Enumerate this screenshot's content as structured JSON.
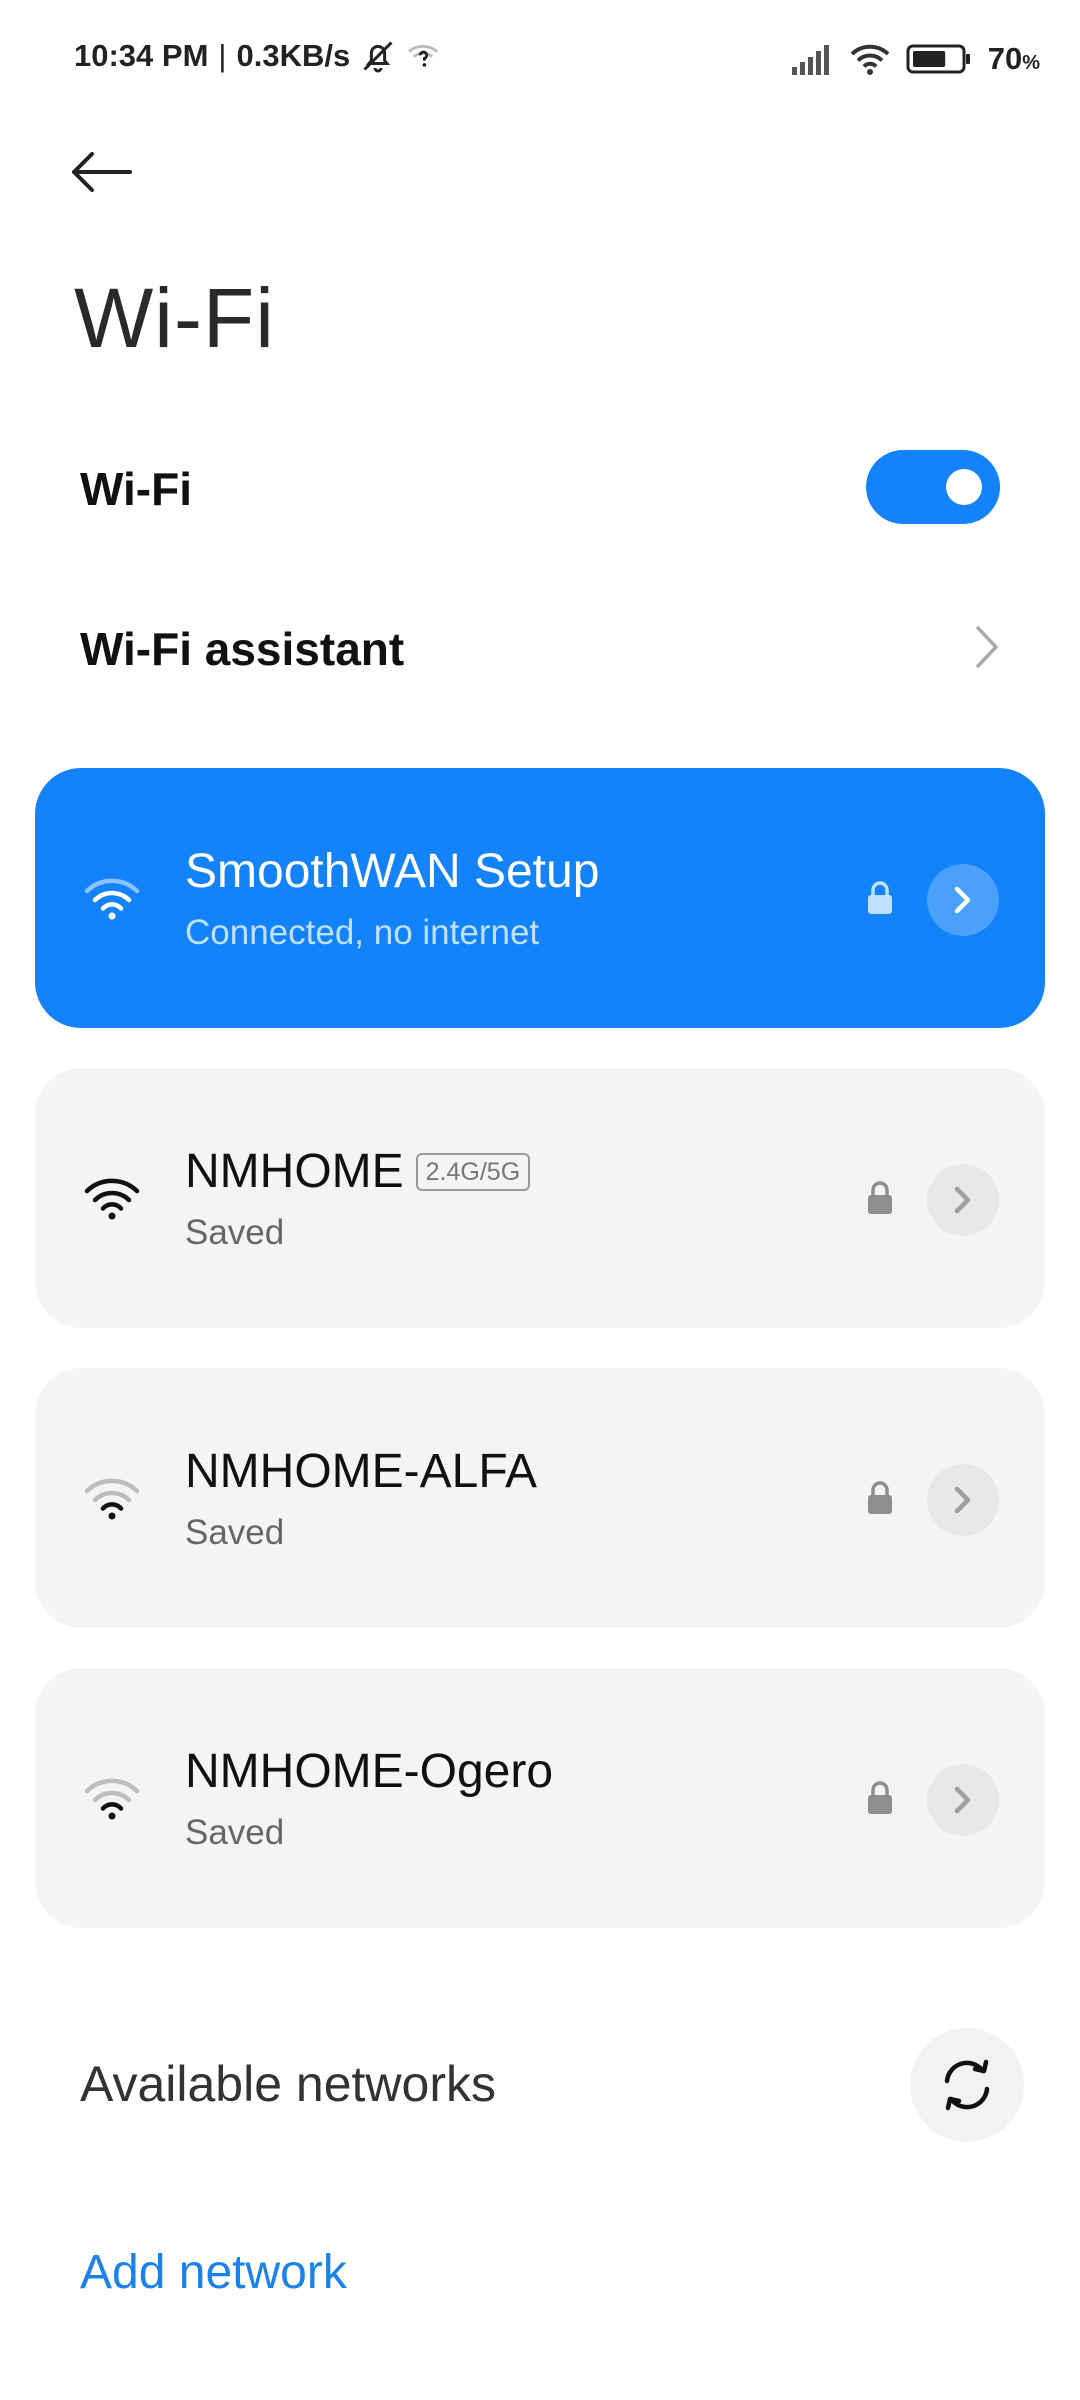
{
  "status_bar": {
    "time": "10:34 PM",
    "separator": "|",
    "speed": "0.3KB/s",
    "battery_value": "70",
    "battery_unit": "%",
    "icons": [
      "bell-off-icon",
      "wifi-question-icon",
      "signal-icon",
      "wifi-icon",
      "battery-icon"
    ]
  },
  "header": {
    "title": "Wi-Fi"
  },
  "wifi_row": {
    "label": "Wi-Fi",
    "enabled": true
  },
  "assistant_row": {
    "label": "Wi-Fi assistant"
  },
  "networks": [
    {
      "name": "SmoothWAN Setup",
      "status": "Connected, no internet",
      "band": "",
      "active": true
    },
    {
      "name": "NMHOME",
      "status": "Saved",
      "band": "2.4G/5G",
      "active": false
    },
    {
      "name": "NMHOME-ALFA",
      "status": "Saved",
      "band": "",
      "active": false
    },
    {
      "name": "NMHOME-Ogero",
      "status": "Saved",
      "band": "",
      "active": false
    }
  ],
  "available": {
    "label": "Available networks"
  },
  "add_network": {
    "label": "Add network"
  },
  "colors": {
    "accent": "#1482f8",
    "link": "#1a82ea",
    "card_bg": "#f4f4f4"
  }
}
